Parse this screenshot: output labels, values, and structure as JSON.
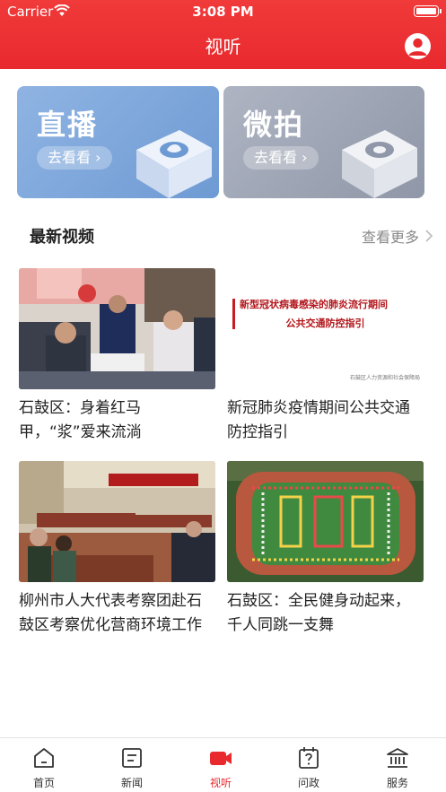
{
  "status_bar": {
    "carrier": "Carrier",
    "time": "3:08 PM"
  },
  "header": {
    "title": "视听"
  },
  "cards": [
    {
      "title": "直播",
      "button": "去看看"
    },
    {
      "title": "微拍",
      "button": "去看看"
    }
  ],
  "section": {
    "title": "最新视频",
    "more": "查看更多"
  },
  "videos": [
    {
      "title": "石鼓区：身着红马甲，“浆”爱来流淌"
    },
    {
      "title": "新冠肺炎疫情期间公共交通防控指引",
      "thumb_line1": "新型冠状病毒感染的肺炎流行期间",
      "thumb_line2": "公共交通防控指引",
      "thumb_footer": "石鼓区人力资源和社会保障局"
    },
    {
      "title": "柳州市人大代表考察团赴石鼓区考察优化营商环境工作"
    },
    {
      "title": "石鼓区：全民健身动起来，千人同跳一支舞"
    }
  ],
  "tabs": [
    {
      "label": "首页",
      "icon": "home-icon"
    },
    {
      "label": "新闻",
      "icon": "news-icon"
    },
    {
      "label": "视听",
      "icon": "video-camera-icon",
      "active": true
    },
    {
      "label": "问政",
      "icon": "question-calendar-icon"
    },
    {
      "label": "服务",
      "icon": "service-building-icon"
    }
  ],
  "colors": {
    "brand_red": "#e8292e",
    "live_card": "#7ea6da",
    "micro_card": "#9ea5b5"
  }
}
